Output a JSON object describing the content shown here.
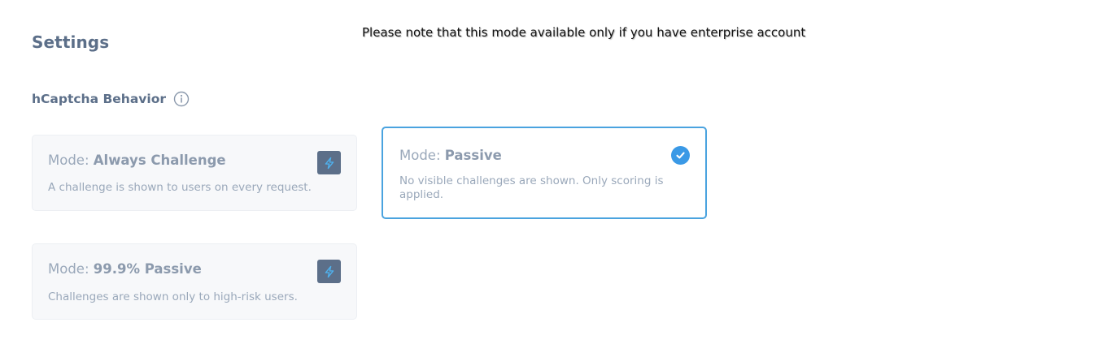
{
  "page": {
    "title": "Settings",
    "notice": "Please note that this mode available only if you have enterprise account"
  },
  "behavior": {
    "label": "hCaptcha Behavior",
    "info_icon": "info-circle-icon"
  },
  "modes": [
    {
      "prefix": "Mode:",
      "name": "Always Challenge",
      "description": "A challenge is shown to users on every request.",
      "selected": false,
      "icon": "lightning-bolt-icon"
    },
    {
      "prefix": "Mode:",
      "name": "Passive",
      "description": "No visible challenges are shown. Only scoring is applied.",
      "selected": true,
      "icon": "check-circle-icon"
    },
    {
      "prefix": "Mode:",
      "name": "99.9% Passive",
      "description": "Challenges are shown only to high-risk users.",
      "selected": false,
      "icon": "lightning-bolt-icon"
    }
  ],
  "colors": {
    "accent": "#3a99e6",
    "selected_border": "#4aa3df",
    "heading": "#5c6f89",
    "muted_text": "#9aa8ba",
    "card_background": "#f7f8fa"
  }
}
